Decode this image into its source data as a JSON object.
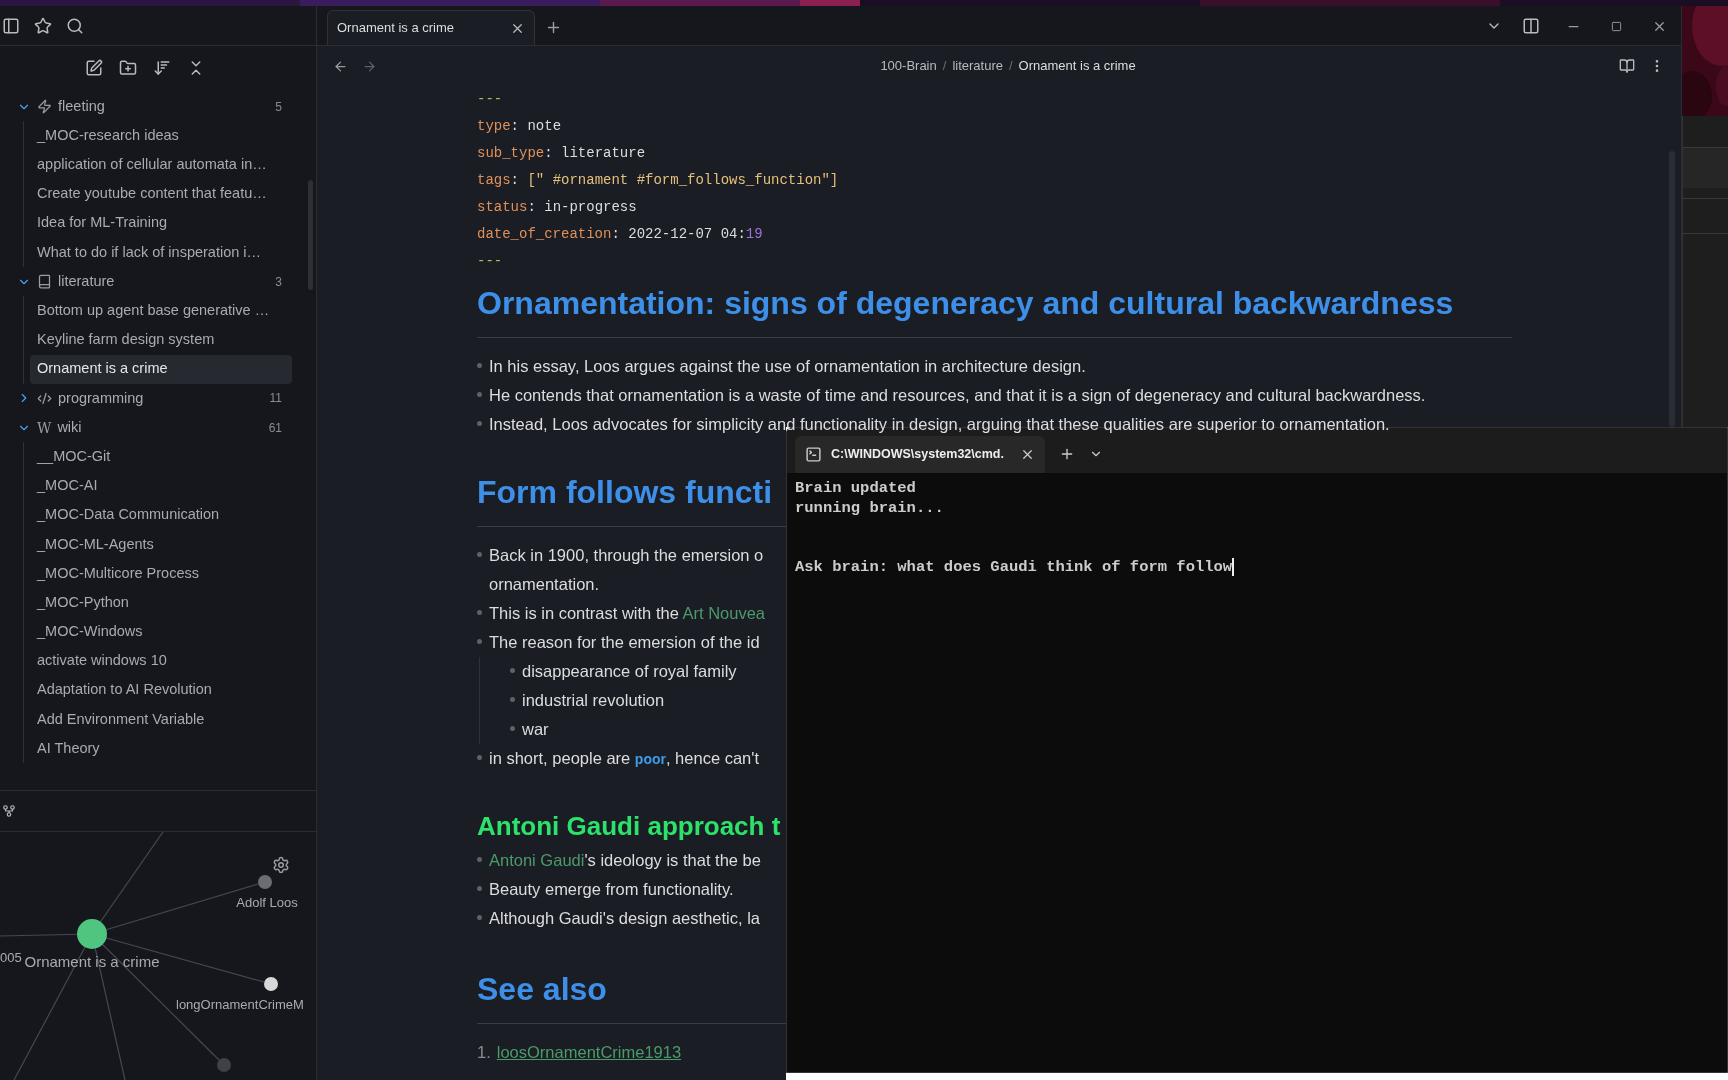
{
  "sidebar": {
    "tree": [
      {
        "label": "fleeting",
        "kind": "bolt",
        "count": "5",
        "expanded": true,
        "children": [
          {
            "label": "_MOC-research ideas",
            "selected": false
          },
          {
            "label": "application of cellular automata in…",
            "selected": false
          },
          {
            "label": "Create youtube content that featu…",
            "selected": false
          },
          {
            "label": "Idea for ML-Training",
            "selected": false
          },
          {
            "label": "What to do if lack of insperation i…",
            "selected": false
          }
        ]
      },
      {
        "label": "literature",
        "kind": "book",
        "count": "3",
        "expanded": true,
        "children": [
          {
            "label": "Bottom up agent base generative …",
            "selected": false
          },
          {
            "label": "Keyline farm design system",
            "selected": false
          },
          {
            "label": "Ornament is a crime",
            "selected": true
          }
        ]
      },
      {
        "label": "programming",
        "kind": "code",
        "count": "11",
        "expanded": false
      },
      {
        "label": "wiki",
        "kind": "letter",
        "icon_text": "W",
        "count": "61",
        "expanded": true,
        "children": [
          {
            "label": "__MOC-Git",
            "selected": false
          },
          {
            "label": "_MOC-AI",
            "selected": false
          },
          {
            "label": "_MOC-Data Communication",
            "selected": false
          },
          {
            "label": "_MOC-ML-Agents",
            "selected": false
          },
          {
            "label": "_MOC-Multicore Process",
            "selected": false
          },
          {
            "label": "_MOC-Python",
            "selected": false
          },
          {
            "label": "_MOC-Windows",
            "selected": false
          },
          {
            "label": "activate windows 10",
            "selected": false
          },
          {
            "label": "Adaptation to AI Revolution",
            "selected": false
          },
          {
            "label": "Add Environment Variable",
            "selected": false
          },
          {
            "label": "AI Theory",
            "selected": false
          }
        ]
      }
    ]
  },
  "graph": {
    "nodes": [
      {
        "label": "Ornament is a crime",
        "kind": "current"
      },
      {
        "label": "Adolf Loos",
        "kind": "note"
      },
      {
        "label": "longOrnamentCrimeM",
        "kind": "linked"
      },
      {
        "label": "005",
        "kind": "offscreen"
      }
    ]
  },
  "editor": {
    "tabs": [
      {
        "title": "Ornament is a crime",
        "selected": true
      }
    ],
    "breadcrumb": [
      "100-Brain",
      "/",
      "literature",
      "/",
      "Ornament is a crime"
    ],
    "frontmatter": {
      "open": "---",
      "close": "---",
      "fields": [
        {
          "parts": [
            {
              "text": "type",
              "kind": "key"
            },
            {
              "text": ": ",
              "kind": "plain"
            },
            {
              "text": "note",
              "kind": "plain"
            }
          ]
        },
        {
          "parts": [
            {
              "text": "sub_type",
              "kind": "key"
            },
            {
              "text": ": ",
              "kind": "plain"
            },
            {
              "text": "literature",
              "kind": "plain"
            }
          ]
        },
        {
          "parts": [
            {
              "text": "tags",
              "kind": "key"
            },
            {
              "text": ": ",
              "kind": "plain"
            },
            {
              "text": "[\" #ornament #form_follows_function\"]",
              "kind": "string"
            }
          ]
        },
        {
          "parts": [
            {
              "text": "status",
              "kind": "key"
            },
            {
              "text": ": ",
              "kind": "plain"
            },
            {
              "text": "in-progress",
              "kind": "plain"
            }
          ]
        },
        {
          "parts": [
            {
              "text": "date_of_creation",
              "kind": "key"
            },
            {
              "text": ": ",
              "kind": "plain"
            },
            {
              "text": "2022-12-07 04:",
              "kind": "plain"
            },
            {
              "text": "19",
              "kind": "number"
            }
          ]
        }
      ]
    },
    "blocks": [
      {
        "kind": "h1",
        "text": "Ornamentation: signs of degeneracy and cultural backwardness"
      },
      {
        "kind": "bullet",
        "parts": [
          {
            "text": "In his essay, Loos argues against the use of ornamentation in architecture design.",
            "kind": "text"
          }
        ]
      },
      {
        "kind": "bullet",
        "parts": [
          {
            "text": "He contends that ornamentation is a waste of time and resources, and that it is a sign of degeneracy and cultural backwardness.",
            "kind": "text"
          }
        ]
      },
      {
        "kind": "bullet",
        "parts": [
          {
            "text": "Instead, Loos advocates for simplicity and functionality in design, arguing that these qualities are superior to ornamentation.",
            "kind": "text"
          }
        ]
      },
      {
        "kind": "h1",
        "text": "Form follows functi"
      },
      {
        "kind": "bullet",
        "parts": [
          {
            "text": "Back in 1900, through the emersion o",
            "kind": "text"
          }
        ],
        "continuation": "ornamentation."
      },
      {
        "kind": "bullet",
        "parts": [
          {
            "text": "This is in contrast with the ",
            "kind": "text"
          },
          {
            "text": "Art Nouvea",
            "kind": "link"
          }
        ]
      },
      {
        "kind": "bullet",
        "parts": [
          {
            "text": "The reason for the emersion of the id",
            "kind": "text"
          }
        ],
        "children": [
          {
            "kind": "bullet",
            "parts": [
              {
                "text": "disappearance of royal family",
                "kind": "text"
              }
            ]
          },
          {
            "kind": "bullet",
            "parts": [
              {
                "text": "industrial revolution",
                "kind": "text"
              }
            ]
          },
          {
            "kind": "bullet",
            "parts": [
              {
                "text": "war",
                "kind": "text"
              }
            ]
          }
        ]
      },
      {
        "kind": "bullet",
        "parts": [
          {
            "text": "in short, people are ",
            "kind": "text"
          },
          {
            "text": "poor",
            "kind": "code"
          },
          {
            "text": ", hence can't",
            "kind": "text"
          }
        ]
      },
      {
        "kind": "h2",
        "text": "Antoni Gaudi approach t"
      },
      {
        "kind": "bullet",
        "parts": [
          {
            "text": "Antoni Gaudi",
            "kind": "link"
          },
          {
            "text": "'s ideology is that the be",
            "kind": "text"
          }
        ]
      },
      {
        "kind": "bullet",
        "parts": [
          {
            "text": "Beauty emerge from functionality.",
            "kind": "text"
          }
        ]
      },
      {
        "kind": "bullet",
        "parts": [
          {
            "text": "Although Gaudi's design aesthetic, la",
            "kind": "text"
          }
        ]
      },
      {
        "kind": "h1",
        "text": "See also"
      },
      {
        "kind": "numbered",
        "number": "1.",
        "parts": [
          {
            "text": "loosOrnamentCrime1913",
            "kind": "link"
          }
        ]
      }
    ]
  },
  "terminal": {
    "tabs": [
      {
        "title": "C:\\WINDOWS\\system32\\cmd.",
        "selected": true
      }
    ],
    "lines": [
      {
        "text": "Brain updated",
        "kind": "output"
      },
      {
        "text": "running brain...",
        "kind": "output"
      },
      {
        "text": "Ask brain: what does Gaudi think of form follow",
        "kind": "prompt"
      }
    ]
  }
}
